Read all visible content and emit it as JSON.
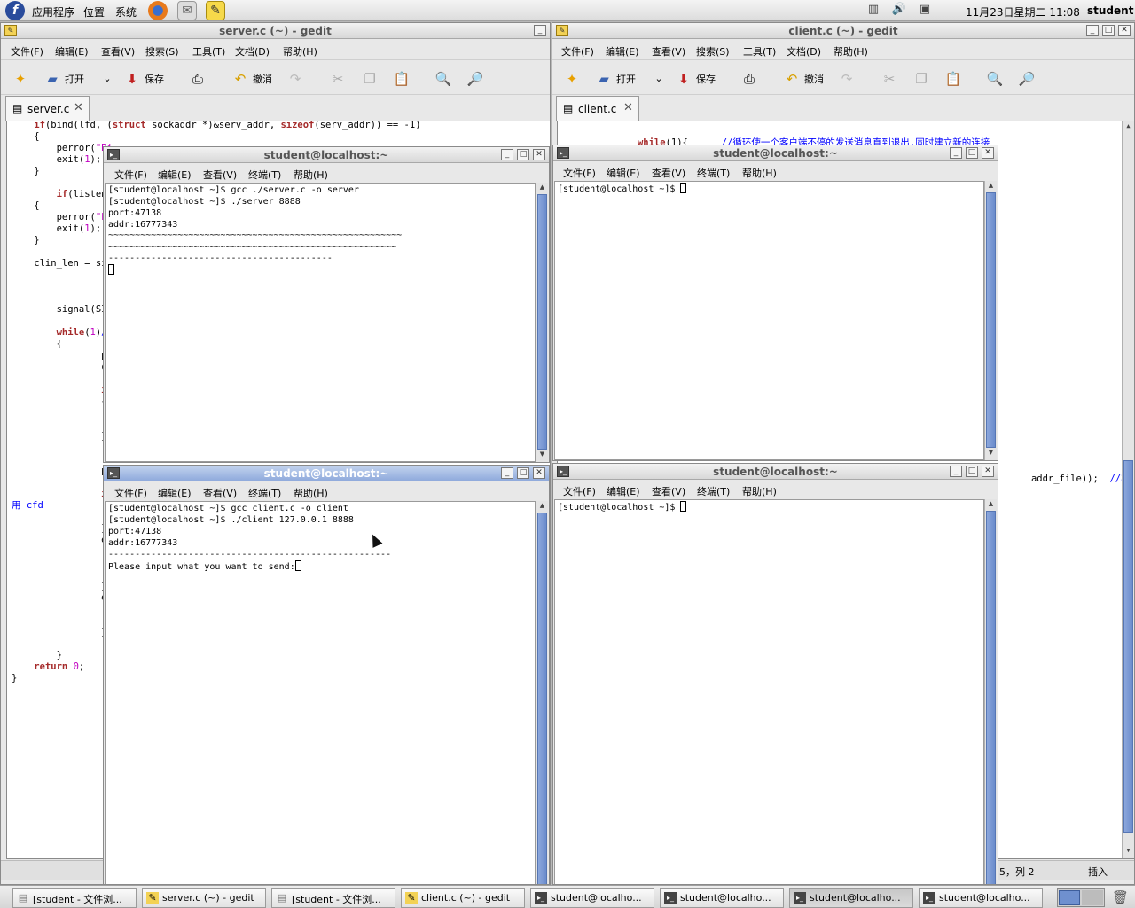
{
  "top_panel": {
    "menus": [
      "应用程序",
      "位置",
      "系统"
    ],
    "datetime": "11月23日星期二 11:08",
    "user": "student"
  },
  "server_gedit": {
    "title": "server.c (~) - gedit",
    "menu": [
      "文件(F)",
      "编辑(E)",
      "查看(V)",
      "搜索(S)",
      "工具(T)",
      "文档(D)",
      "帮助(H)"
    ],
    "toolbar": {
      "open": "打开",
      "save": "保存",
      "undo": "撤消"
    },
    "tab": "server.c",
    "code_fragments": [
      "    if(bind(lfd, (struct sockaddr *)&serv_addr, sizeof(serv_addr)) == -1)",
      "    {",
      "        perror(\"Bi",
      "        exit(1);",
      "    }",
      "",
      "        if(listen",
      "    {",
      "        perror(\"L",
      "        exit(1);",
      "    }",
      "",
      "    clin_len = si",
      "",
      "",
      "",
      "        signal(SIG",
      "",
      "        while(1)//",
      "        {",
      "                pr",
      "                c",
      "",
      "                if",
      "                {",
      "",
      "",
      "                }",
      "",
      "",
      "                p",
      "",
      "                if",
      "用 cfd",
      "",
      "                }",
      "                el",
      "",
      "",
      "",
      "                }",
      "                el",
      "",
      "",
      "                }",
      "",
      "        }",
      "    return 0;",
      "}"
    ]
  },
  "client_gedit": {
    "title": "client.c (~) - gedit",
    "menu": [
      "文件(F)",
      "编辑(E)",
      "查看(V)",
      "搜索(S)",
      "工具(T)",
      "文档(D)",
      "帮助(H)"
    ],
    "toolbar": {
      "open": "打开",
      "save": "保存",
      "undo": "撤消"
    },
    "tab": "client.c",
    "line1_kw": "while",
    "line1_rest": "(1){",
    "line1_comment": "//循环使一个客户端不停的发送消息直到退出,同时建立新的连接",
    "peek_code": "addr_file));",
    "peek_comment": "//客户",
    "status_pos": "5，列 2",
    "status_mode": "插入"
  },
  "term_server": {
    "title": "student@localhost:~",
    "menu": [
      "文件(F)",
      "编辑(E)",
      "查看(V)",
      "终端(T)",
      "帮助(H)"
    ],
    "lines": [
      "[student@localhost ~]$ gcc ./server.c -o server",
      "[student@localhost ~]$ ./server 8888",
      "port:47138",
      "addr:16777343",
      "~~~~~~~~~~~~~~~~~~~~~~~~~~~~~~~~~~~~~~~~~~~~~~~~~~~~~~~",
      "~~~~~~~~~~~~~~~~~~~~~~~~~~~~~~~~~~~~~~~~~~~~~~~~~~~~~~",
      "------------------------------------------"
    ]
  },
  "term_client": {
    "title": "student@localhost:~",
    "menu": [
      "文件(F)",
      "编辑(E)",
      "查看(V)",
      "终端(T)",
      "帮助(H)"
    ],
    "lines": [
      "[student@localhost ~]$ gcc client.c -o client",
      "[student@localhost ~]$ ./client 127.0.0.1 8888",
      "port:47138",
      "addr:16777343",
      "-----------------------------------------------------",
      "Please input what you want to send:"
    ]
  },
  "term_tr": {
    "title": "student@localhost:~",
    "menu": [
      "文件(F)",
      "编辑(E)",
      "查看(V)",
      "终端(T)",
      "帮助(H)"
    ],
    "prompt": "[student@localhost ~]$ "
  },
  "term_br": {
    "title": "student@localhost:~",
    "menu": [
      "文件(F)",
      "编辑(E)",
      "查看(V)",
      "终端(T)",
      "帮助(H)"
    ],
    "prompt": "[student@localhost ~]$ "
  },
  "taskbar": [
    {
      "label": "[student - 文件浏...",
      "icon": "folder-icon"
    },
    {
      "label": "server.c (~) - gedit",
      "icon": "gedit-icon"
    },
    {
      "label": "[student - 文件浏...",
      "icon": "folder-icon"
    },
    {
      "label": "client.c (~) - gedit",
      "icon": "gedit-icon"
    },
    {
      "label": "student@localho...",
      "icon": "terminal-icon"
    },
    {
      "label": "student@localho...",
      "icon": "terminal-icon"
    },
    {
      "label": "student@localho...",
      "icon": "terminal-icon"
    },
    {
      "label": "student@localho...",
      "icon": "terminal-icon"
    }
  ]
}
